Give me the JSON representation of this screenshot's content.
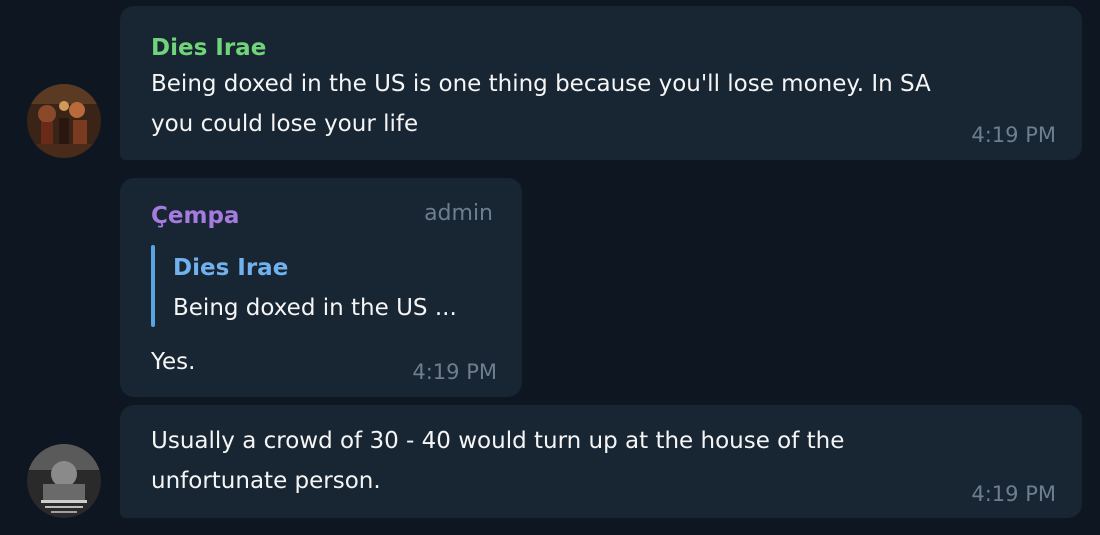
{
  "messages": [
    {
      "sender": "Dies Irae",
      "sender_color": "#6fd47a",
      "avatar": "painting-avatar",
      "lines": [
        "Being doxed in the US is one thing because you'll lose money. In SA",
        "you could lose your life"
      ],
      "time": "4:19 PM"
    },
    {
      "sender": "Çempa",
      "sender_color": "#a57be0",
      "role": "admin",
      "reply": {
        "name": "Dies Irae",
        "text": "Being doxed in the US ..."
      },
      "lines": [
        "Yes."
      ],
      "time": "4:19 PM"
    },
    {
      "avatar": "grayscale-avatar",
      "lines": [
        "Usually a crowd of 30 - 40 would turn up at the house of the",
        "unfortunate person."
      ],
      "time": "4:19 PM"
    }
  ],
  "colors": {
    "background": "#0e1621",
    "bubble": "#182533",
    "time": "#6d7f8f",
    "reply_bar": "#5aa4e0"
  }
}
